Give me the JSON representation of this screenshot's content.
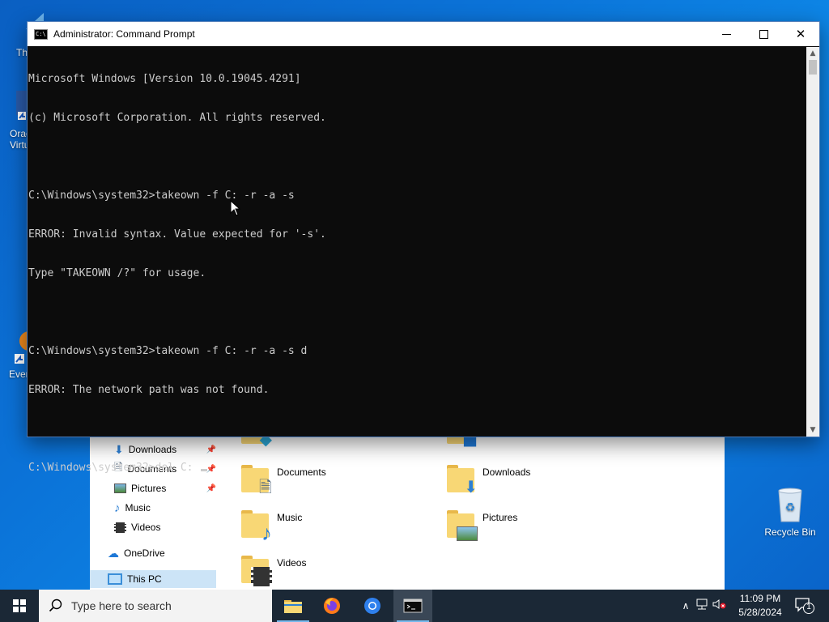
{
  "desktop": {
    "partial_labels": [
      "Th",
      "Orac",
      "Virtu",
      "Ever"
    ],
    "recycle_bin_label": "Recycle Bin"
  },
  "explorer": {
    "nav": [
      {
        "label": "Downloads",
        "icon": "download-arrow-icon",
        "pinned": true
      },
      {
        "label": "Documents",
        "icon": "document-icon",
        "pinned": true
      },
      {
        "label": "Pictures",
        "icon": "picture-icon",
        "pinned": true
      },
      {
        "label": "Music",
        "icon": "music-note-icon",
        "pinned": false
      },
      {
        "label": "Videos",
        "icon": "film-icon",
        "pinned": false
      },
      {
        "label": "OneDrive",
        "icon": "cloud-icon",
        "pinned": false
      },
      {
        "label": "This PC",
        "icon": "computer-icon",
        "pinned": false
      }
    ],
    "folders": [
      {
        "label": "Documents"
      },
      {
        "label": "Downloads"
      },
      {
        "label": "Music"
      },
      {
        "label": "Pictures"
      },
      {
        "label": "Videos"
      }
    ]
  },
  "cmd": {
    "title": "Administrator: Command Prompt",
    "lines": [
      "Microsoft Windows [Version 10.0.19045.4291]",
      "(c) Microsoft Corporation. All rights reserved.",
      "",
      "C:\\Windows\\system32>takeown -f C: -r -a -s",
      "ERROR: Invalid syntax. Value expected for '-s'.",
      "Type \"TAKEOWN /?\" for usage.",
      "",
      "C:\\Windows\\system32>takeown -f C: -r -a -s d",
      "ERROR: The network path was not found.",
      ""
    ],
    "current_prompt": "C:\\Windows\\system32>del C: "
  },
  "taskbar": {
    "search_placeholder": "Type here to search",
    "time": "11:09 PM",
    "date": "5/28/2024",
    "notification_count": "1"
  },
  "colors": {
    "console_bg": "#0c0c0c",
    "console_fg": "#cccccc",
    "taskbar_bg": "#1b2836",
    "accent": "#76b9ed"
  }
}
